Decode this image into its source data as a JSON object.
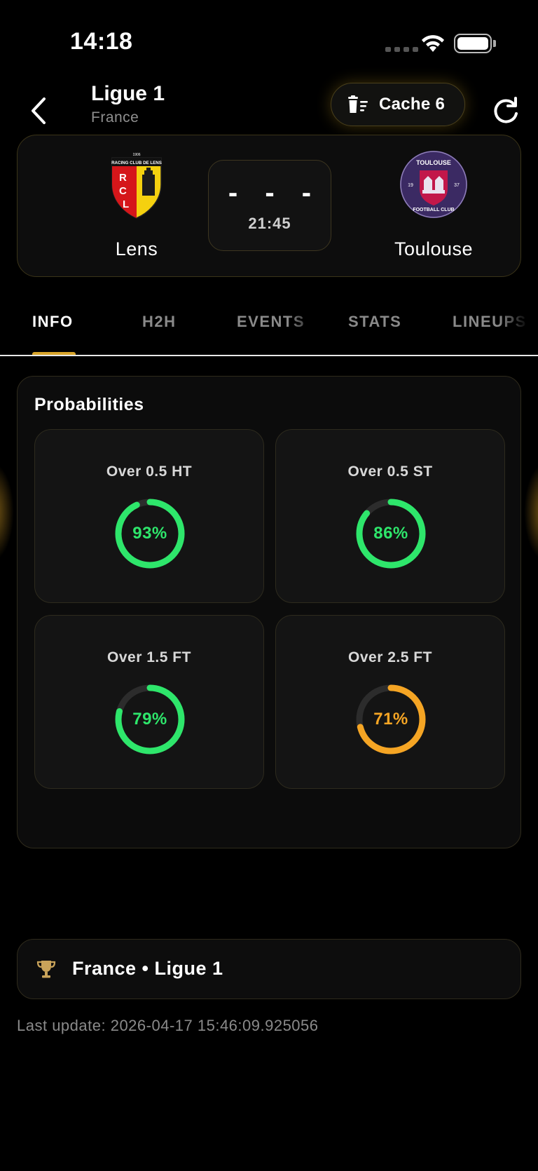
{
  "status_bar": {
    "time": "14:18",
    "icons": [
      "signal-icon",
      "wifi-icon",
      "battery-icon"
    ]
  },
  "header": {
    "title": "Ligue 1",
    "subtitle": "France",
    "cache_label": "Cache 6",
    "icons": [
      "back-chevron-icon",
      "trash-icon",
      "refresh-icon"
    ]
  },
  "match": {
    "home_team": "Lens",
    "away_team": "Toulouse",
    "score": "- - -",
    "kickoff": "21:45",
    "home_logo_text": "RCL",
    "home_logo_banner": "RACING CLUB DE LENS",
    "home_logo_year": "1906",
    "away_logo_text_top": "TOULOUSE",
    "away_logo_text_bottom": "FOOTBALL CLUB",
    "away_logo_year_left": "19",
    "away_logo_year_right": "37"
  },
  "tabs": [
    {
      "label": "INFO",
      "active": true
    },
    {
      "label": "H2H",
      "active": false
    },
    {
      "label": "EVENTS",
      "active": false
    },
    {
      "label": "STATS",
      "active": false
    },
    {
      "label": "LINEUPS",
      "active": false
    }
  ],
  "probabilities": {
    "title": "Probabilities",
    "items": [
      {
        "label": "Over 0.5 HT",
        "value": 93,
        "value_text": "93%",
        "color": "#2ee66b"
      },
      {
        "label": "Over 0.5 ST",
        "value": 86,
        "value_text": "86%",
        "color": "#2ee66b"
      },
      {
        "label": "Over 1.5 FT",
        "value": 79,
        "value_text": "79%",
        "color": "#2ee66b"
      },
      {
        "label": "Over 2.5 FT",
        "value": 71,
        "value_text": "71%",
        "color": "#f5a524"
      }
    ]
  },
  "competition": {
    "label": "France • Ligue 1",
    "icon": "trophy-icon"
  },
  "footer": {
    "last_update": "Last update: 2026-04-17 15:46:09.925056"
  },
  "colors": {
    "accent": "#d9a52b",
    "background": "#000000",
    "card": "#0d0d0d",
    "success": "#2ee66b",
    "warning": "#f5a524"
  }
}
